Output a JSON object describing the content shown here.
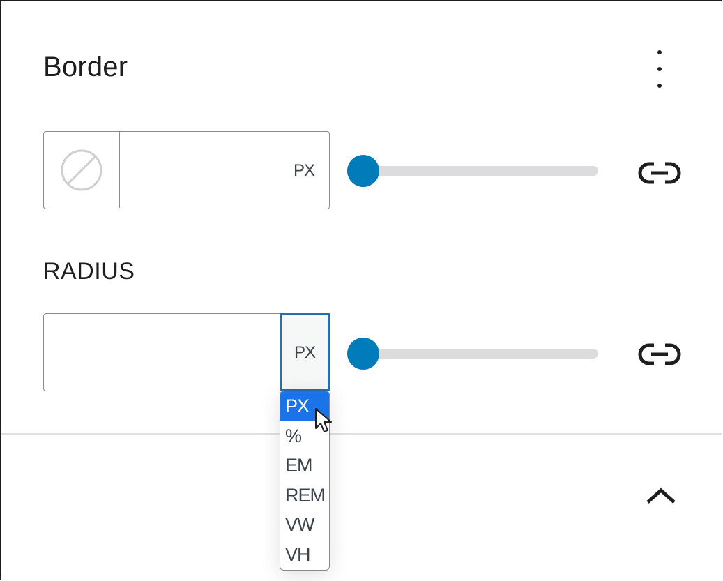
{
  "panel": {
    "title": "Border",
    "more_icon": "more-vertical-icon"
  },
  "border_width": {
    "style_icon": "no-style-icon",
    "value": "",
    "unit": "PX",
    "slider_value": 0,
    "link_icon": "link-sides-icon"
  },
  "radius": {
    "label": "RADIUS",
    "value": "",
    "unit": "PX",
    "slider_value": 0,
    "link_icon": "link-corners-icon"
  },
  "unit_options": [
    {
      "label": "PX",
      "selected": true
    },
    {
      "label": "%",
      "selected": false
    },
    {
      "label": "EM",
      "selected": false
    },
    {
      "label": "REM",
      "selected": false
    },
    {
      "label": "VW",
      "selected": false
    },
    {
      "label": "VH",
      "selected": false
    }
  ],
  "footer": {
    "collapse_icon": "chevron-up-icon"
  },
  "colors": {
    "accent": "#007cba",
    "focus": "#2271b1",
    "selected_option": "#1a73e8",
    "track": "#dcdcde",
    "text": "#1e1e1e"
  }
}
